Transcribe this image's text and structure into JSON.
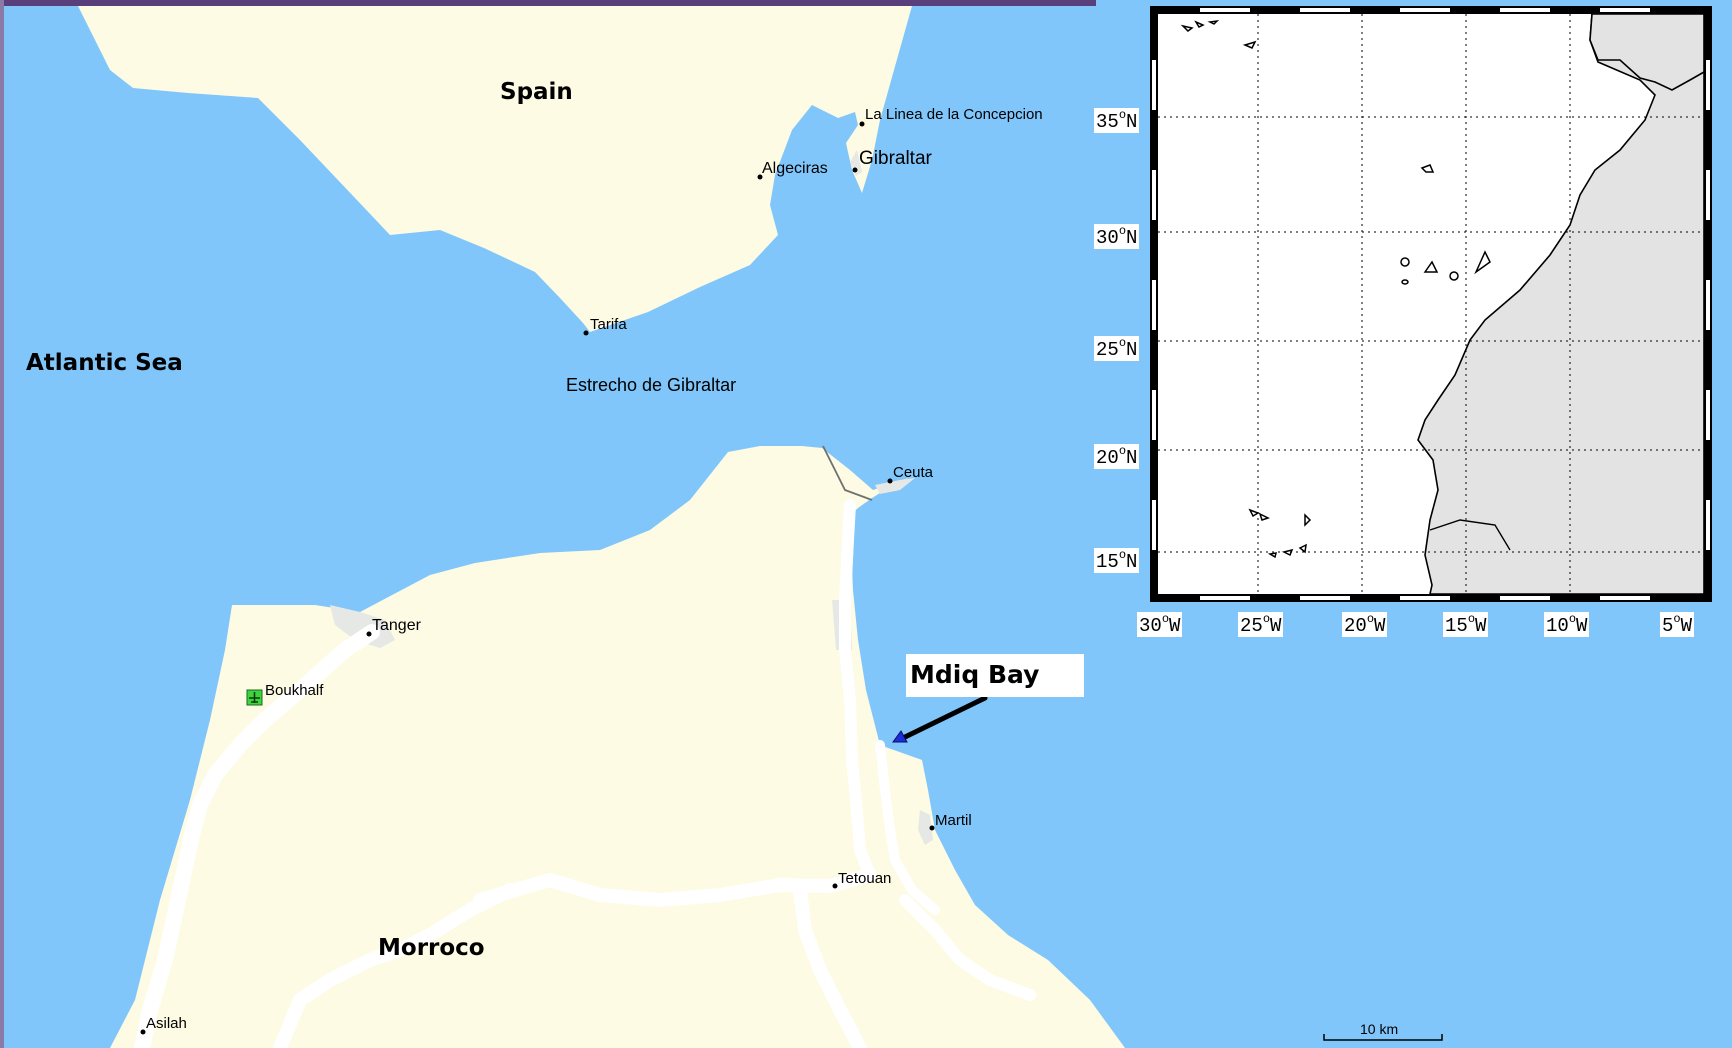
{
  "map": {
    "countries": {
      "spain": "Spain",
      "morocco": "Morroco"
    },
    "sea_label": "Atlantic Sea",
    "strait_label": "Estrecho de Gibraltar",
    "places": {
      "la_linea": "La Linea de la Concepcion",
      "gibraltar": "Gibraltar",
      "algeciras": "Algeciras",
      "tarifa": "Tarifa",
      "ceuta": "Ceuta",
      "tanger": "Tanger",
      "boukhalf": "Boukhalf",
      "martil": "Martil",
      "tetouan": "Tetouan",
      "asilah": "Asilah"
    },
    "callout": {
      "label": "Mdiq Bay",
      "marker": "triangle-marker"
    },
    "scale_bar": "10 km",
    "colors": {
      "water": "#80c6fb",
      "land": "#fdfbe3",
      "urban": "#e6e8e6",
      "road": "#ffffff",
      "airport": "#3fd43f"
    }
  },
  "inset": {
    "lat_ticks": [
      {
        "deg": "35",
        "hemi": "N"
      },
      {
        "deg": "30",
        "hemi": "N"
      },
      {
        "deg": "25",
        "hemi": "N"
      },
      {
        "deg": "20",
        "hemi": "N"
      },
      {
        "deg": "15",
        "hemi": "N"
      }
    ],
    "lon_ticks": [
      {
        "deg": "30",
        "hemi": "W"
      },
      {
        "deg": "25",
        "hemi": "W"
      },
      {
        "deg": "20",
        "hemi": "W"
      },
      {
        "deg": "15",
        "hemi": "W"
      },
      {
        "deg": "10",
        "hemi": "W"
      },
      {
        "deg": "5",
        "hemi": "W"
      }
    ],
    "degree_symbol": "o",
    "colors": {
      "ocean": "#ffffff",
      "land": "#e3e3e3",
      "frame": "#000000"
    }
  }
}
